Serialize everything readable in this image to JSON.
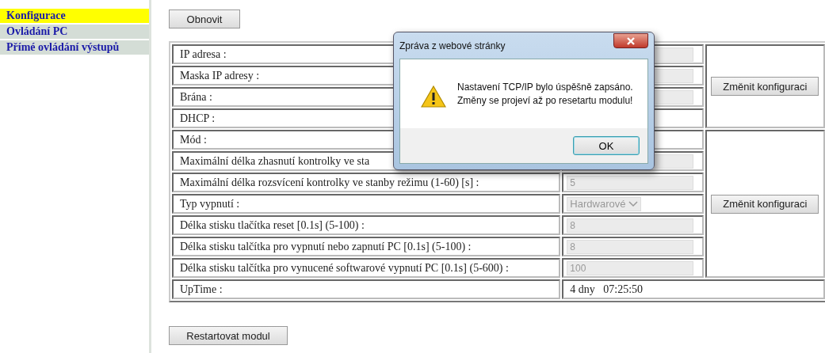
{
  "sidebar": {
    "items": [
      {
        "label": "Konfigurace",
        "selected": true
      },
      {
        "label": "Ovládání PC",
        "selected": false
      },
      {
        "label": "Přímé ovládání výstupů",
        "selected": false
      }
    ]
  },
  "refresh_button": "Obnovit",
  "groups": [
    {
      "button": "Změnit konfiguraci",
      "rows": [
        {
          "label": "IP adresa :",
          "kind": "input",
          "disabled": true
        },
        {
          "label": "Maska IP adresy :",
          "kind": "input",
          "disabled": true
        },
        {
          "label": "Brána :",
          "kind": "input",
          "disabled": true
        },
        {
          "label": "DHCP :",
          "kind": "empty"
        }
      ]
    },
    {
      "button": "Změnit konfiguraci",
      "rows": [
        {
          "label": "Mód :",
          "kind": "empty"
        },
        {
          "label": "Maximální délka zhasnutí kontrolky ve sta",
          "kind": "input",
          "disabled": true
        },
        {
          "label": "Maximální délka rozsvícení kontrolky ve stanby režimu (1-60) [s] :",
          "kind": "input",
          "value": "5",
          "disabled": true
        },
        {
          "label": "Typ vypnutí :",
          "kind": "select",
          "value": "Hardwarové",
          "disabled": true
        },
        {
          "label": "Délka stisku tlačítka reset [0.1s] (5-100) :",
          "kind": "input",
          "value": "8",
          "disabled": true
        },
        {
          "label": "Délka stisku talčítka pro vypnutí nebo zapnutí PC [0.1s] (5-100) :",
          "kind": "input",
          "value": "8",
          "disabled": true
        },
        {
          "label": "Délka stisku talčítka pro vynucené softwarové vypnutí PC [0.1s] (5-600) :",
          "kind": "input",
          "value": "100",
          "disabled": true
        }
      ]
    }
  ],
  "uptime": {
    "label": "UpTime :",
    "value": "4 dny   07:25:50"
  },
  "restart_button": "Restartovat modul",
  "dialog": {
    "title": "Zpráva z webové stránky",
    "message_lines": [
      "Nastavení TCP/IP bylo úspěšně zapsáno.",
      "Změny se projeví až po resetartu modulu!"
    ],
    "ok_button": "OK"
  }
}
